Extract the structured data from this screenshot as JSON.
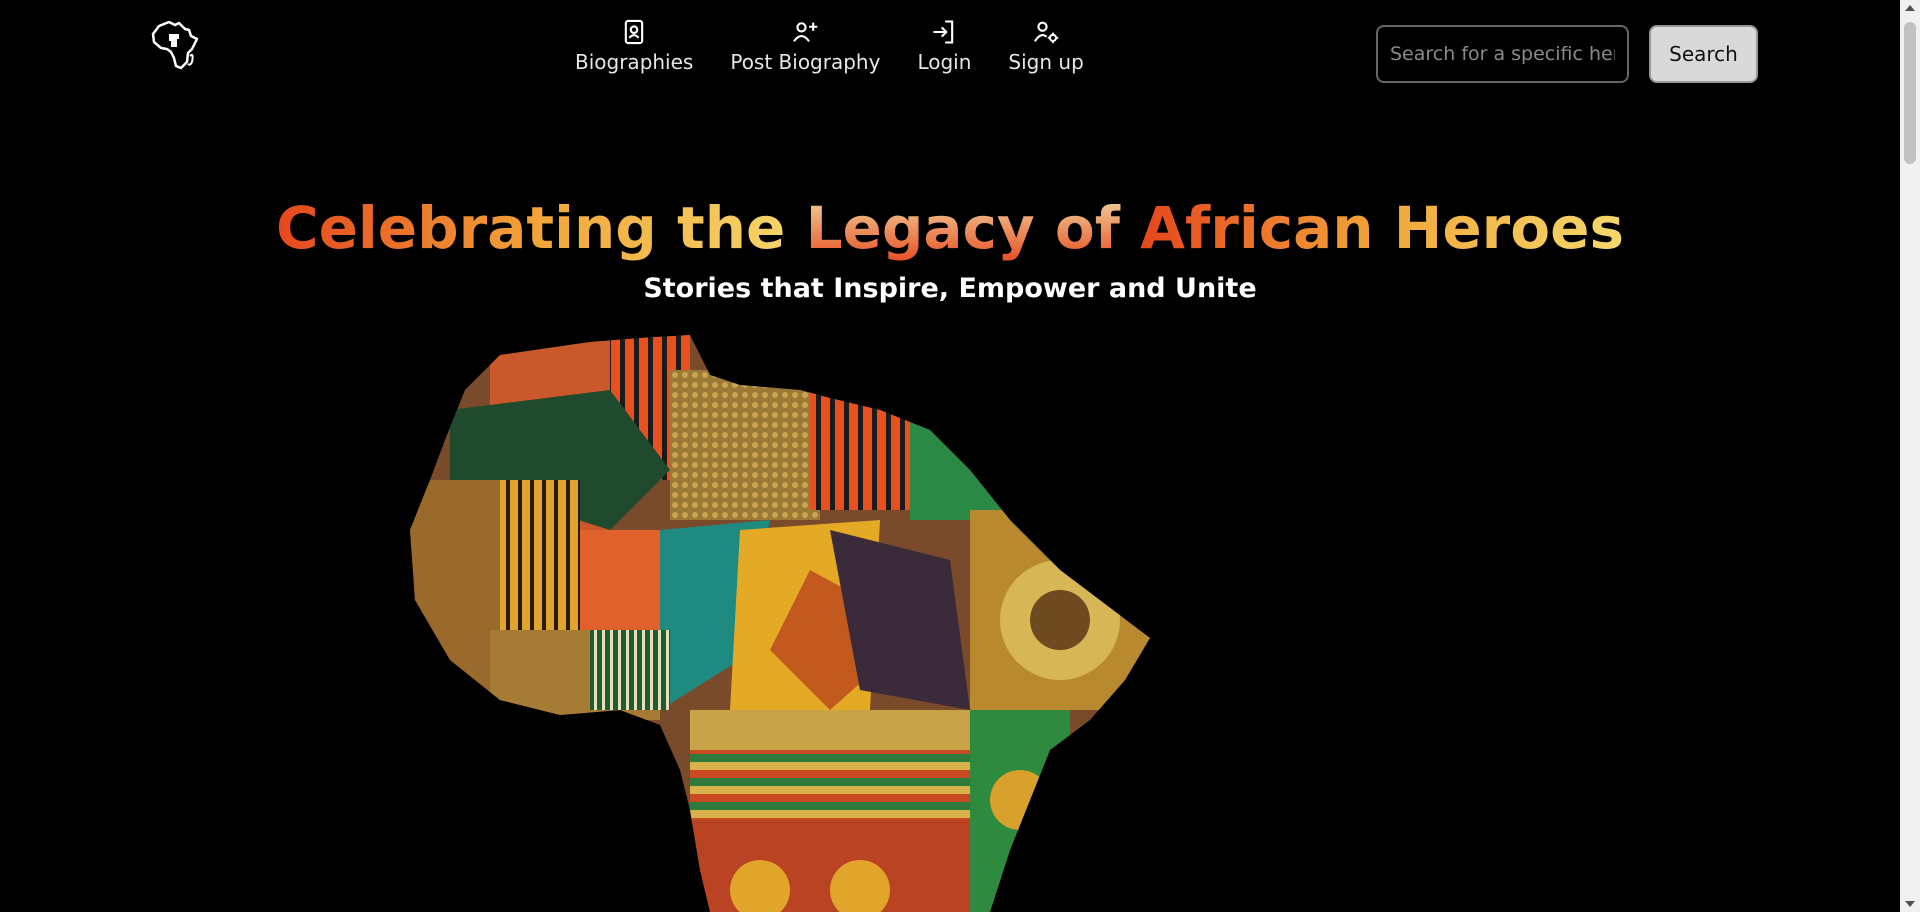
{
  "header": {
    "logo_icon": "africa-fist-logo-icon",
    "nav": [
      {
        "label": "Biographies",
        "icon": "id-badge-icon"
      },
      {
        "label": "Post Biography",
        "icon": "person-add-icon"
      },
      {
        "label": "Login",
        "icon": "login-arrow-icon"
      },
      {
        "label": "Sign up",
        "icon": "person-gear-icon"
      }
    ],
    "search": {
      "placeholder": "Search for a specific hero...",
      "value": "",
      "button_label": "Search"
    }
  },
  "hero": {
    "title_parts": [
      "Celebrating the ",
      "Legacy of ",
      "African Heroes"
    ],
    "subtitle": "Stories that Inspire, Empower and Unite"
  },
  "colors": {
    "background": "#000000",
    "accent_red": "#e5461d",
    "accent_orange": "#f2a63a",
    "accent_yellow": "#f5d86c",
    "accent_green": "#1f6b3a",
    "accent_teal": "#1f8a80"
  }
}
